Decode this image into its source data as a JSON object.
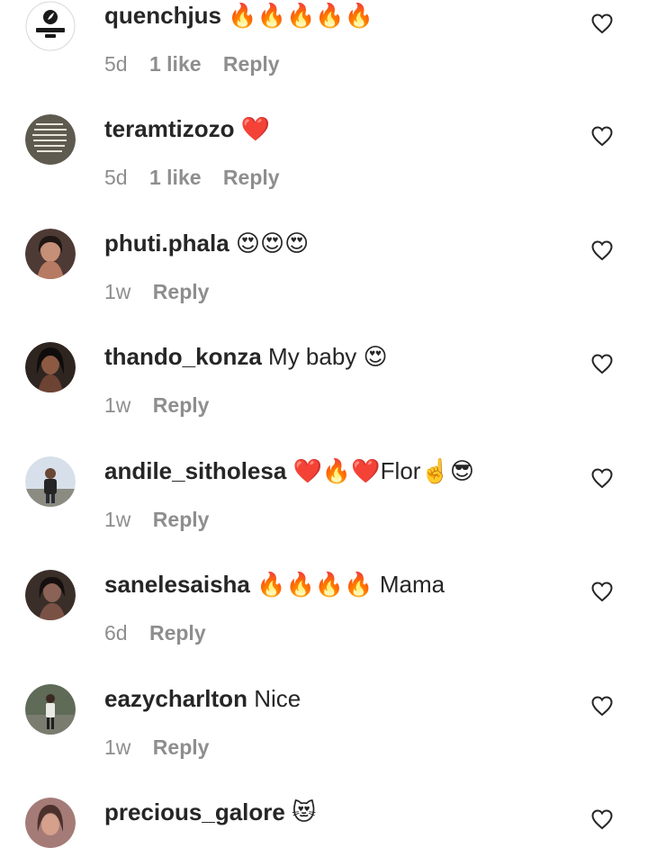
{
  "comments": [
    {
      "username": "quenchjus",
      "text": "🔥🔥🔥🔥🔥",
      "time": "5d",
      "likes": "1 like",
      "reply": "Reply",
      "avatar": "quench-jus-logo-avatar"
    },
    {
      "username": "teramtizozo",
      "text": "❤️",
      "time": "5d",
      "likes": "1 like",
      "reply": "Reply",
      "avatar": "text-quote-avatar"
    },
    {
      "username": "phuti.phala",
      "text": "😍😍😍",
      "time": "1w",
      "likes": "",
      "reply": "Reply",
      "avatar": "woman-portrait-avatar"
    },
    {
      "username": "thando_konza",
      "text": "My baby 😍",
      "time": "1w",
      "likes": "",
      "reply": "Reply",
      "avatar": "woman-portrait-avatar"
    },
    {
      "username": "andile_sitholesa",
      "text": "❤️🔥❤️Flor☝️😎",
      "time": "1w",
      "likes": "",
      "reply": "Reply",
      "avatar": "man-outdoor-avatar"
    },
    {
      "username": "sanelesaisha",
      "text": "🔥🔥🔥🔥 Mama",
      "time": "6d",
      "likes": "",
      "reply": "Reply",
      "avatar": "woman-portrait-avatar"
    },
    {
      "username": "eazycharlton",
      "text": "Nice",
      "time": "1w",
      "likes": "",
      "reply": "Reply",
      "avatar": "man-standing-avatar"
    },
    {
      "username": "precious_galore",
      "text": "😻",
      "time": "",
      "likes": "",
      "reply": "",
      "avatar": "woman-portrait-avatar"
    }
  ],
  "icons": {
    "like": "heart-outline-icon"
  },
  "colors": {
    "text": "#262626",
    "meta": "#8e8e8e"
  }
}
